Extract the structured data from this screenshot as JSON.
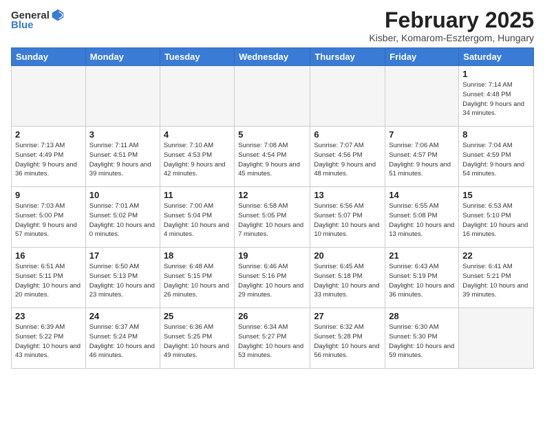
{
  "header": {
    "logo_general": "General",
    "logo_blue": "Blue",
    "month_year": "February 2025",
    "location": "Kisber, Komarom-Esztergom, Hungary"
  },
  "days_of_week": [
    "Sunday",
    "Monday",
    "Tuesday",
    "Wednesday",
    "Thursday",
    "Friday",
    "Saturday"
  ],
  "weeks": [
    [
      {
        "day": "",
        "info": ""
      },
      {
        "day": "",
        "info": ""
      },
      {
        "day": "",
        "info": ""
      },
      {
        "day": "",
        "info": ""
      },
      {
        "day": "",
        "info": ""
      },
      {
        "day": "",
        "info": ""
      },
      {
        "day": "1",
        "info": "Sunrise: 7:14 AM\nSunset: 4:48 PM\nDaylight: 9 hours and 34 minutes."
      }
    ],
    [
      {
        "day": "2",
        "info": "Sunrise: 7:13 AM\nSunset: 4:49 PM\nDaylight: 9 hours and 36 minutes."
      },
      {
        "day": "3",
        "info": "Sunrise: 7:11 AM\nSunset: 4:51 PM\nDaylight: 9 hours and 39 minutes."
      },
      {
        "day": "4",
        "info": "Sunrise: 7:10 AM\nSunset: 4:53 PM\nDaylight: 9 hours and 42 minutes."
      },
      {
        "day": "5",
        "info": "Sunrise: 7:08 AM\nSunset: 4:54 PM\nDaylight: 9 hours and 45 minutes."
      },
      {
        "day": "6",
        "info": "Sunrise: 7:07 AM\nSunset: 4:56 PM\nDaylight: 9 hours and 48 minutes."
      },
      {
        "day": "7",
        "info": "Sunrise: 7:06 AM\nSunset: 4:57 PM\nDaylight: 9 hours and 51 minutes."
      },
      {
        "day": "8",
        "info": "Sunrise: 7:04 AM\nSunset: 4:59 PM\nDaylight: 9 hours and 54 minutes."
      }
    ],
    [
      {
        "day": "9",
        "info": "Sunrise: 7:03 AM\nSunset: 5:00 PM\nDaylight: 9 hours and 57 minutes."
      },
      {
        "day": "10",
        "info": "Sunrise: 7:01 AM\nSunset: 5:02 PM\nDaylight: 10 hours and 0 minutes."
      },
      {
        "day": "11",
        "info": "Sunrise: 7:00 AM\nSunset: 5:04 PM\nDaylight: 10 hours and 4 minutes."
      },
      {
        "day": "12",
        "info": "Sunrise: 6:58 AM\nSunset: 5:05 PM\nDaylight: 10 hours and 7 minutes."
      },
      {
        "day": "13",
        "info": "Sunrise: 6:56 AM\nSunset: 5:07 PM\nDaylight: 10 hours and 10 minutes."
      },
      {
        "day": "14",
        "info": "Sunrise: 6:55 AM\nSunset: 5:08 PM\nDaylight: 10 hours and 13 minutes."
      },
      {
        "day": "15",
        "info": "Sunrise: 6:53 AM\nSunset: 5:10 PM\nDaylight: 10 hours and 16 minutes."
      }
    ],
    [
      {
        "day": "16",
        "info": "Sunrise: 6:51 AM\nSunset: 5:11 PM\nDaylight: 10 hours and 20 minutes."
      },
      {
        "day": "17",
        "info": "Sunrise: 6:50 AM\nSunset: 5:13 PM\nDaylight: 10 hours and 23 minutes."
      },
      {
        "day": "18",
        "info": "Sunrise: 6:48 AM\nSunset: 5:15 PM\nDaylight: 10 hours and 26 minutes."
      },
      {
        "day": "19",
        "info": "Sunrise: 6:46 AM\nSunset: 5:16 PM\nDaylight: 10 hours and 29 minutes."
      },
      {
        "day": "20",
        "info": "Sunrise: 6:45 AM\nSunset: 5:18 PM\nDaylight: 10 hours and 33 minutes."
      },
      {
        "day": "21",
        "info": "Sunrise: 6:43 AM\nSunset: 5:19 PM\nDaylight: 10 hours and 36 minutes."
      },
      {
        "day": "22",
        "info": "Sunrise: 6:41 AM\nSunset: 5:21 PM\nDaylight: 10 hours and 39 minutes."
      }
    ],
    [
      {
        "day": "23",
        "info": "Sunrise: 6:39 AM\nSunset: 5:22 PM\nDaylight: 10 hours and 43 minutes."
      },
      {
        "day": "24",
        "info": "Sunrise: 6:37 AM\nSunset: 5:24 PM\nDaylight: 10 hours and 46 minutes."
      },
      {
        "day": "25",
        "info": "Sunrise: 6:36 AM\nSunset: 5:25 PM\nDaylight: 10 hours and 49 minutes."
      },
      {
        "day": "26",
        "info": "Sunrise: 6:34 AM\nSunset: 5:27 PM\nDaylight: 10 hours and 53 minutes."
      },
      {
        "day": "27",
        "info": "Sunrise: 6:32 AM\nSunset: 5:28 PM\nDaylight: 10 hours and 56 minutes."
      },
      {
        "day": "28",
        "info": "Sunrise: 6:30 AM\nSunset: 5:30 PM\nDaylight: 10 hours and 59 minutes."
      },
      {
        "day": "",
        "info": ""
      }
    ]
  ]
}
